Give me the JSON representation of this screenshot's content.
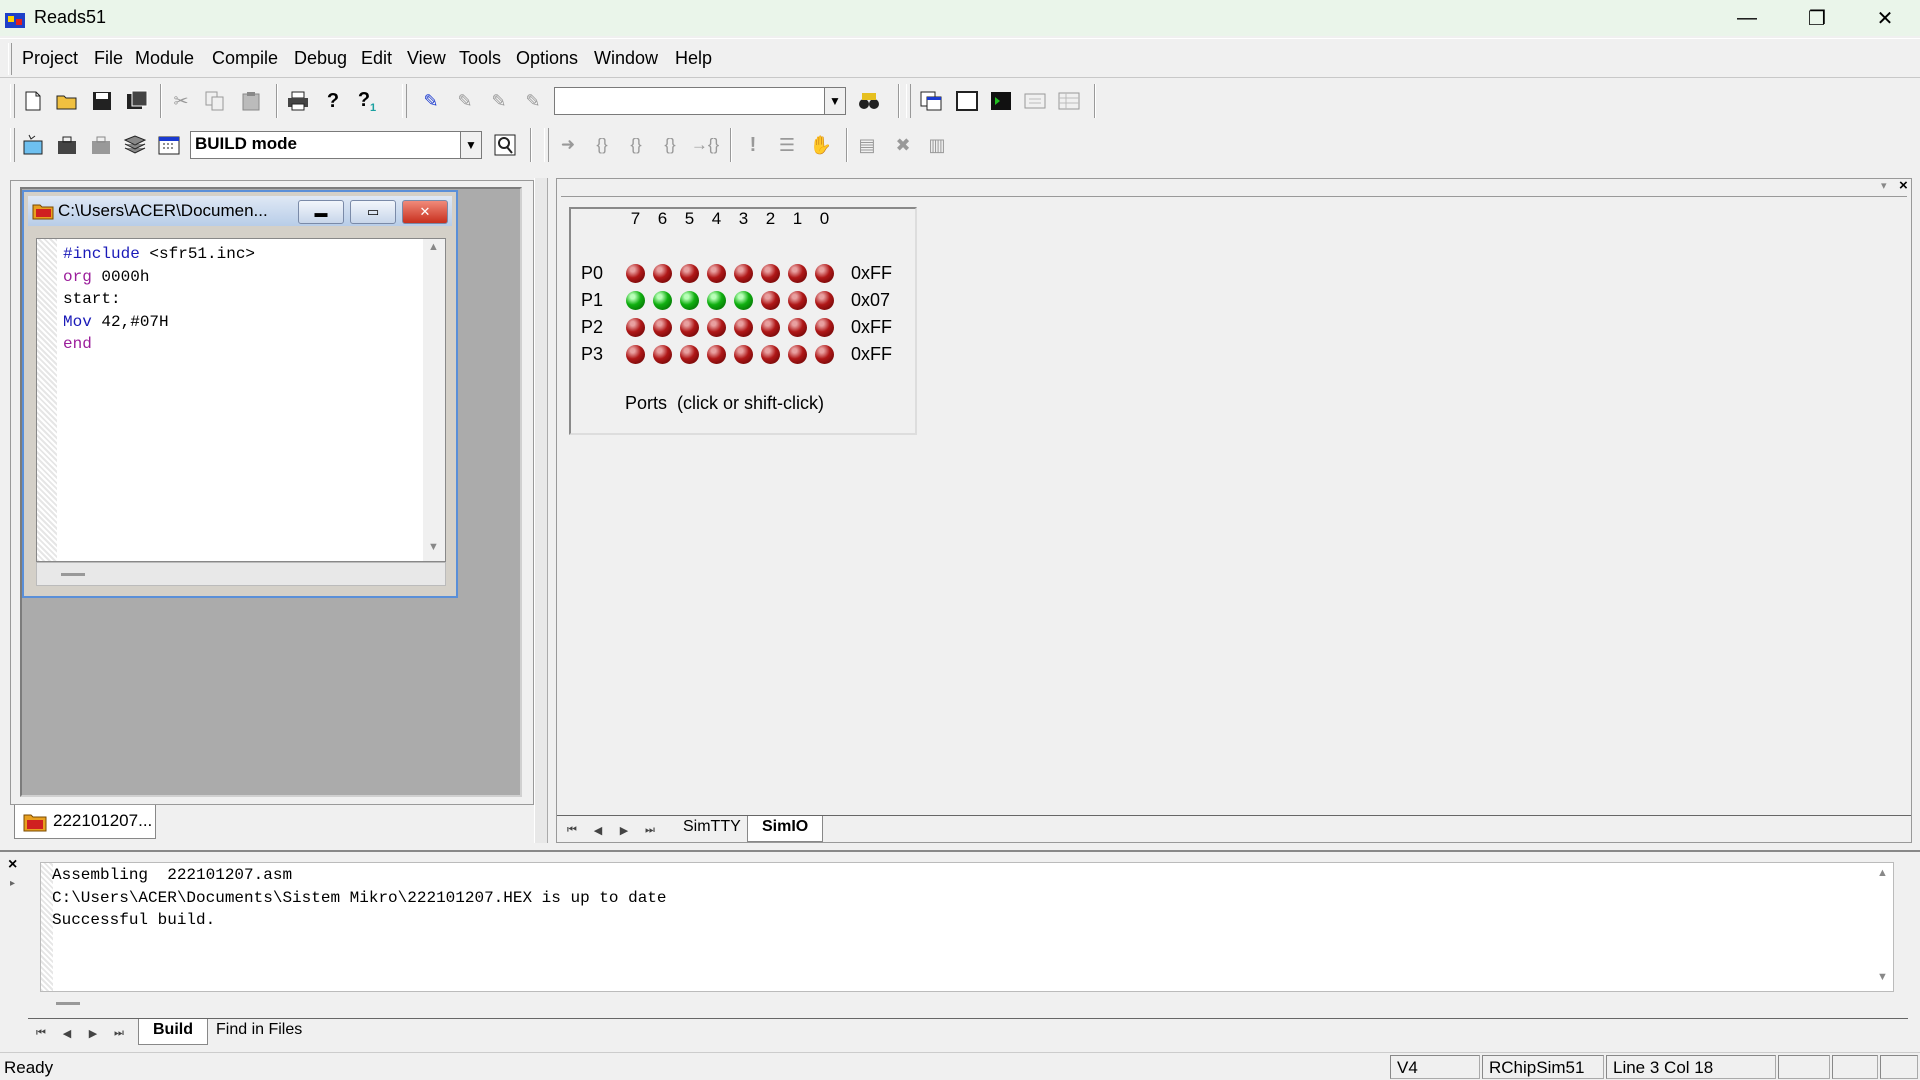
{
  "window": {
    "title": "Reads51",
    "minimize": "—",
    "restore": "❐",
    "close": "✕"
  },
  "menu": [
    "Project",
    "File",
    "Module",
    "Compile",
    "Debug",
    "Edit",
    "View",
    "Tools",
    "Options",
    "Window",
    "Help"
  ],
  "toolbar": {
    "search_value": "",
    "mode_value": "BUILD mode"
  },
  "editor": {
    "title": "C:\\Users\\ACER\\Documen...",
    "lines": [
      {
        "a": "#include",
        "b": " <sfr51.inc>"
      },
      {
        "a": "org",
        "b": " 0000h"
      },
      {
        "a": "",
        "b": "start:"
      },
      {
        "a": "Mov",
        "b": " 42,#07H"
      },
      {
        "a": "end",
        "b": ""
      }
    ]
  },
  "project_tab": "222101207...",
  "simio": {
    "bits": [
      "7",
      "6",
      "5",
      "4",
      "3",
      "2",
      "1",
      "0"
    ],
    "ports": [
      {
        "name": "P0",
        "value": "0xFF"
      },
      {
        "name": "P1",
        "value": "0x07"
      },
      {
        "name": "P2",
        "value": "0xFF"
      },
      {
        "name": "P3",
        "value": "0xFF"
      }
    ],
    "caption": "Ports  (click or shift-click)"
  },
  "right_tabs": {
    "tab1": "SimTTY",
    "tab2": "SimIO"
  },
  "output": {
    "lines": [
      "Assembling  222101207.asm",
      "C:\\Users\\ACER\\Documents\\Sistem Mikro\\222101207.HEX is up to date",
      "Successful build."
    ]
  },
  "output_tabs": {
    "tab1": "Build",
    "tab2": "Find in Files"
  },
  "status": {
    "message": "Ready",
    "version": "V4",
    "sim": "RChipSim51",
    "position": "Line 3 Col 18"
  },
  "colors": {
    "led_on": "#10b010",
    "led_off": "#b01818",
    "editor_border": "#5a8fd8"
  }
}
